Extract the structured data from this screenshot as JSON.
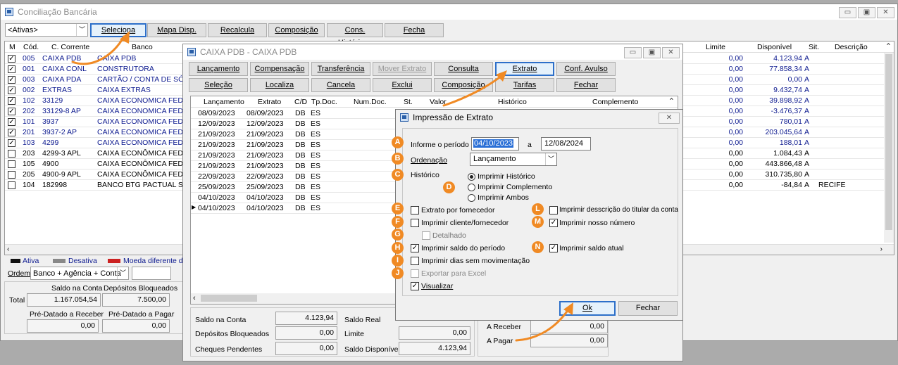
{
  "main": {
    "title": "Conciliação Bancária",
    "filter_value": "<Ativas>",
    "toolbar": [
      "Seleciona",
      "Mapa Disp.",
      "Recalcula",
      "Composição",
      "Cons. Históricos",
      "Fecha"
    ],
    "headers": {
      "m": "M",
      "cod": "Cód.",
      "cc": "C. Corrente",
      "banco": "Banco",
      "limite": "Limite",
      "disp": "Disponível",
      "sit": "Sit.",
      "desc": "Descrição"
    },
    "rows": [
      {
        "checked": true,
        "cod": "005",
        "cc": "CAIXA PDB",
        "banco": "CAIXA PDB",
        "limite": "0,00",
        "disp": "4.123,94",
        "sit": "A",
        "desc": "",
        "blue": true
      },
      {
        "checked": true,
        "cod": "001",
        "cc": "CAIXA CONL",
        "banco": "CONSTRUTORA",
        "limite": "0,00",
        "disp": "77.858,34",
        "sit": "A",
        "desc": "",
        "blue": true
      },
      {
        "checked": true,
        "cod": "003",
        "cc": "CAIXA PDA",
        "banco": "CARTÃO / CONTA DE SÓC",
        "limite": "0,00",
        "disp": "0,00",
        "sit": "A",
        "desc": "",
        "blue": true
      },
      {
        "checked": true,
        "cod": "002",
        "cc": "EXTRAS",
        "banco": "CAIXA EXTRAS",
        "limite": "0,00",
        "disp": "9.432,74",
        "sit": "A",
        "desc": "",
        "blue": true
      },
      {
        "checked": true,
        "cod": "102",
        "cc": "33129",
        "banco": "CAIXA ECONOMICA FEDER",
        "limite": "0,00",
        "disp": "39.898,92",
        "sit": "A",
        "desc": "",
        "blue": true
      },
      {
        "checked": true,
        "cod": "202",
        "cc": "33129-8 AP",
        "banco": "CAIXA ECONOMICA FEDER",
        "limite": "0,00",
        "disp": "-3.476,37",
        "sit": "A",
        "desc": "",
        "blue": true
      },
      {
        "checked": true,
        "cod": "101",
        "cc": "3937",
        "banco": "CAIXA ECONOMICA FEDER",
        "limite": "0,00",
        "disp": "780,01",
        "sit": "A",
        "desc": "",
        "blue": true
      },
      {
        "checked": true,
        "cod": "201",
        "cc": "3937-2 AP",
        "banco": "CAIXA ECONOMICA FEDER",
        "limite": "0,00",
        "disp": "203.045,64",
        "sit": "A",
        "desc": "",
        "blue": true
      },
      {
        "checked": true,
        "cod": "103",
        "cc": "4299",
        "banco": "CAIXA ECONOMICA FEDER",
        "limite": "0,00",
        "disp": "188,01",
        "sit": "A",
        "desc": "",
        "blue": true
      },
      {
        "checked": false,
        "cod": "203",
        "cc": "4299-3 APL",
        "banco": "CAIXA ECONÔMICA FEDER",
        "limite": "0,00",
        "disp": "1.084,43",
        "sit": "A",
        "desc": "",
        "blue": false
      },
      {
        "checked": false,
        "cod": "105",
        "cc": "4900",
        "banco": "CAIXA ECONÔMICA FEDER",
        "limite": "0,00",
        "disp": "443.866,48",
        "sit": "A",
        "desc": "",
        "blue": false
      },
      {
        "checked": false,
        "cod": "205",
        "cc": "4900-9 APL",
        "banco": "CAIXA ECONÔMICA FEDER",
        "limite": "0,00",
        "disp": "310.735,80",
        "sit": "A",
        "desc": "",
        "blue": false
      },
      {
        "checked": false,
        "cod": "104",
        "cc": "182998",
        "banco": "BANCO BTG PACTUAL S.A.",
        "limite": "0,00",
        "disp": "-84,84",
        "sit": "A",
        "desc": "RECIFE",
        "blue": false
      }
    ],
    "legend": {
      "ativa": "Ativa",
      "desativa": "Desativa",
      "moeda": "Moeda diferente da"
    },
    "ordem_label": "Ordem",
    "ordem_value": "Banco + Agência + Conta",
    "saldo_conta_label": "Saldo na Conta",
    "dep_bloq_label": "Depósitos Bloqueados",
    "total_label": "Total",
    "total_saldo": "1.167.054,54",
    "total_dep": "7.500,00",
    "pre_receber_label": "Pré-Datado a Receber",
    "pre_pagar_label": "Pré-Datado a Pagar",
    "pre_receber": "0,00",
    "pre_pagar": "0,00"
  },
  "caixa": {
    "title": "CAIXA PDB  -  CAIXA PDB",
    "toolbar_row1": [
      "Lançamento",
      "Compensação",
      "Transferência",
      "Mover Extrato",
      "Consulta",
      "Extrato",
      "Conf. Avulso"
    ],
    "toolbar_row2": [
      "Seleção",
      "Localiza",
      "Cancela",
      "Exclui",
      "Composição",
      "Tarifas",
      "Fechar"
    ],
    "headers": {
      "lanc": "Lançamento",
      "ext": "Extrato",
      "cd": "C/D",
      "tp": "Tp.Doc.",
      "num": "Num.Doc.",
      "st": "St.",
      "valor": "Valor",
      "hist": "Histórico",
      "comp": "Complemento"
    },
    "rows": [
      {
        "lanc": "08/09/2023",
        "ext": "08/09/2023",
        "cd": "DB",
        "tp": "ES"
      },
      {
        "lanc": "12/09/2023",
        "ext": "12/09/2023",
        "cd": "DB",
        "tp": "ES"
      },
      {
        "lanc": "21/09/2023",
        "ext": "21/09/2023",
        "cd": "DB",
        "tp": "ES"
      },
      {
        "lanc": "21/09/2023",
        "ext": "21/09/2023",
        "cd": "DB",
        "tp": "ES"
      },
      {
        "lanc": "21/09/2023",
        "ext": "21/09/2023",
        "cd": "DB",
        "tp": "ES"
      },
      {
        "lanc": "21/09/2023",
        "ext": "21/09/2023",
        "cd": "DB",
        "tp": "ES"
      },
      {
        "lanc": "22/09/2023",
        "ext": "22/09/2023",
        "cd": "DB",
        "tp": "ES"
      },
      {
        "lanc": "25/09/2023",
        "ext": "25/09/2023",
        "cd": "DB",
        "tp": "ES"
      },
      {
        "lanc": "04/10/2023",
        "ext": "04/10/2023",
        "cd": "DB",
        "tp": "ES"
      },
      {
        "lanc": "04/10/2023",
        "ext": "04/10/2023",
        "cd": "DB",
        "tp": "ES"
      }
    ],
    "saldo_conta_label": "Saldo na Conta",
    "saldo_conta": "4.123,94",
    "dep_bloq_label": "Depósitos Bloqueados",
    "dep_bloq": "0,00",
    "cheques_label": "Cheques Pendentes",
    "cheques": "0,00",
    "saldo_real_label": "Saldo Real",
    "limite_label": "Limite",
    "limite": "0,00",
    "saldo_disp_label": "Saldo Disponível",
    "saldo_disp": "4.123,94",
    "a_receber_label": "A Receber",
    "a_receber": "0,00",
    "a_pagar_label": "A Pagar",
    "a_pagar": "0,00"
  },
  "dialog": {
    "title": "Impressão de Extrato",
    "periodo_label": "Informe o período",
    "periodo_de": "04/10/2023",
    "a_label": "a",
    "periodo_ate": "12/08/2024",
    "ordenacao_label": "Ordenação",
    "ordenacao_value": "Lançamento",
    "historico_label": "Histórico",
    "radio_historico": "Imprimir Histórico",
    "radio_complemento": "Imprimir Complemento",
    "radio_ambos": "Imprimir Ambos",
    "chk_fornecedor": "Extrato por fornecedor",
    "chk_cliente": "Imprimir cliente/fornecedor",
    "chk_detalhado": "Detalhado",
    "chk_saldo_periodo": "Imprimir saldo do período",
    "chk_dias": "Imprimir dias sem movimentação",
    "chk_excel": "Exportar para Excel",
    "chk_visualizar": "Visualizar",
    "chk_titular": "Imprimir desscrição do titular da conta",
    "chk_nosso_numero": "Imprimir nosso número",
    "chk_saldo_atual": "Imprimir saldo atual",
    "ok": "Ok",
    "fechar": "Fechar"
  },
  "markers": [
    "A",
    "B",
    "C",
    "D",
    "E",
    "F",
    "G",
    "H",
    "I",
    "J",
    "L",
    "M",
    "N"
  ],
  "colors": {
    "marker": "#f08a24",
    "selected_border": "#2d6fc9",
    "blue_text": "#0d1a8f"
  }
}
